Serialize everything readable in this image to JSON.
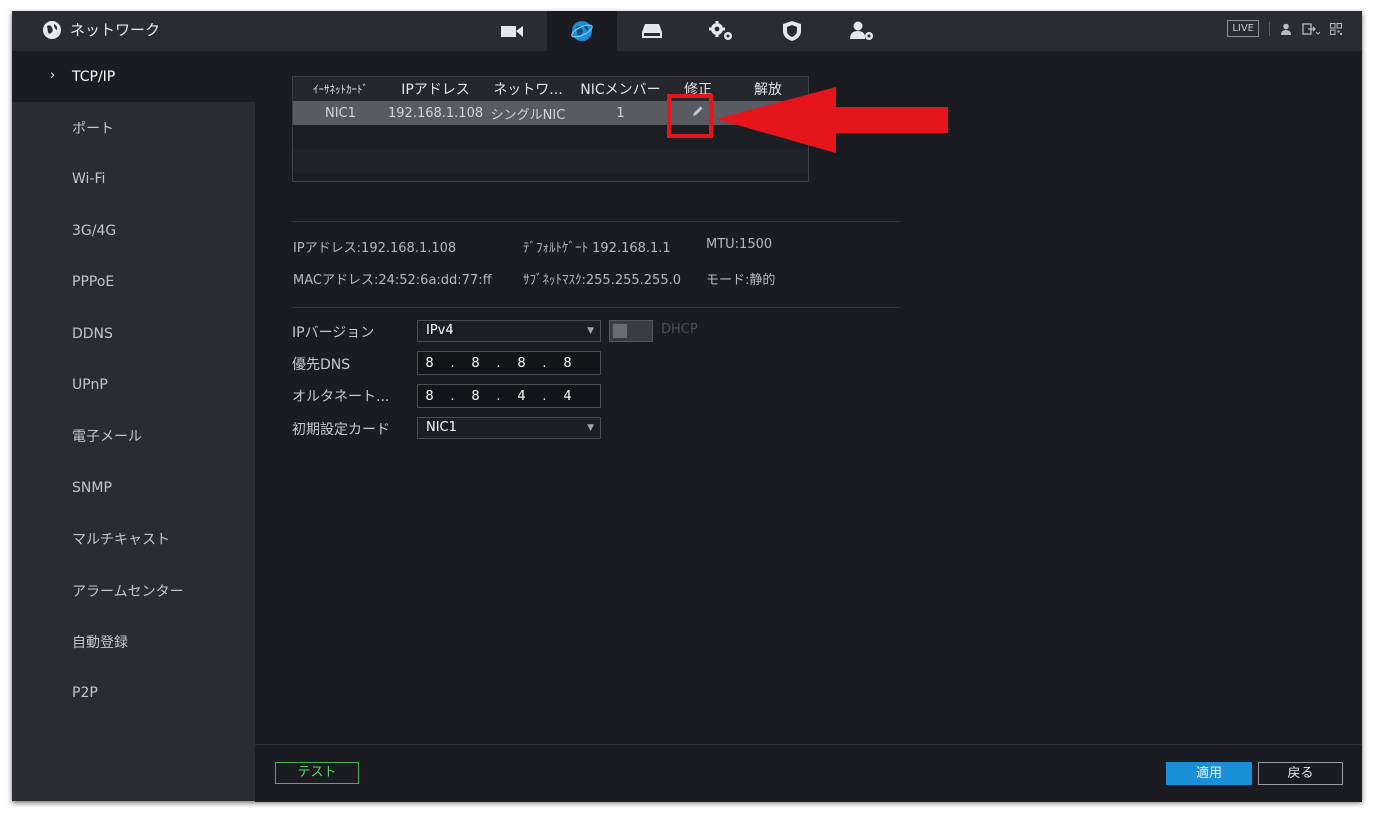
{
  "header": {
    "title": "ネットワーク",
    "tabs": [
      "camera",
      "network",
      "storage",
      "system",
      "security",
      "account"
    ],
    "active_tab": "network",
    "live_label": "LIVE"
  },
  "sidebar": {
    "items": [
      {
        "label": "TCP/IP",
        "active": true
      },
      {
        "label": "ポート"
      },
      {
        "label": "Wi-Fi"
      },
      {
        "label": "3G/4G"
      },
      {
        "label": "PPPoE"
      },
      {
        "label": "DDNS"
      },
      {
        "label": "UPnP"
      },
      {
        "label": "電子メール"
      },
      {
        "label": "SNMP"
      },
      {
        "label": "マルチキャスト"
      },
      {
        "label": "アラームセンター"
      },
      {
        "label": "自動登録"
      },
      {
        "label": "P2P"
      }
    ]
  },
  "nic_table": {
    "columns": [
      "ｲｰｻﾈｯﾄｶｰﾄﾞ",
      "IPアドレス",
      "ネットワ...",
      "NICメンバー",
      "修正",
      "解放"
    ],
    "rows": [
      {
        "card": "NIC1",
        "ip": "192.168.1.108",
        "network": "シングルNIC",
        "member": "1"
      }
    ]
  },
  "info": {
    "ip": "IPアドレス:192.168.1.108",
    "gateway": "ﾃﾞﾌｫﾙﾄｹﾞｰﾄ 192.168.1.1",
    "mtu": "MTU:1500",
    "mac": "MACアドレス:24:52:6a:dd:77:ff",
    "subnet": "ｻﾌﾞﾈｯﾄﾏｽｸ:255.255.255.0",
    "mode": "モード:静的"
  },
  "form": {
    "ip_version_label": "IPバージョン",
    "ip_version_value": "IPv4",
    "dhcp_label": "DHCP",
    "preferred_dns_label": "優先DNS",
    "preferred_dns": [
      "8",
      ".",
      "8",
      ".",
      "8",
      ".",
      "8"
    ],
    "alternate_dns_label": "オルタネート...",
    "alternate_dns": [
      "8",
      ".",
      "8",
      ".",
      "4",
      ".",
      "4"
    ],
    "default_card_label": "初期設定カード",
    "default_card_value": "NIC1"
  },
  "buttons": {
    "test": "テスト",
    "apply": "適用",
    "back": "戻る"
  },
  "colors": {
    "accent": "#1b8ed8",
    "annotation": "#e5151c",
    "test_green": "#5fd36b"
  }
}
